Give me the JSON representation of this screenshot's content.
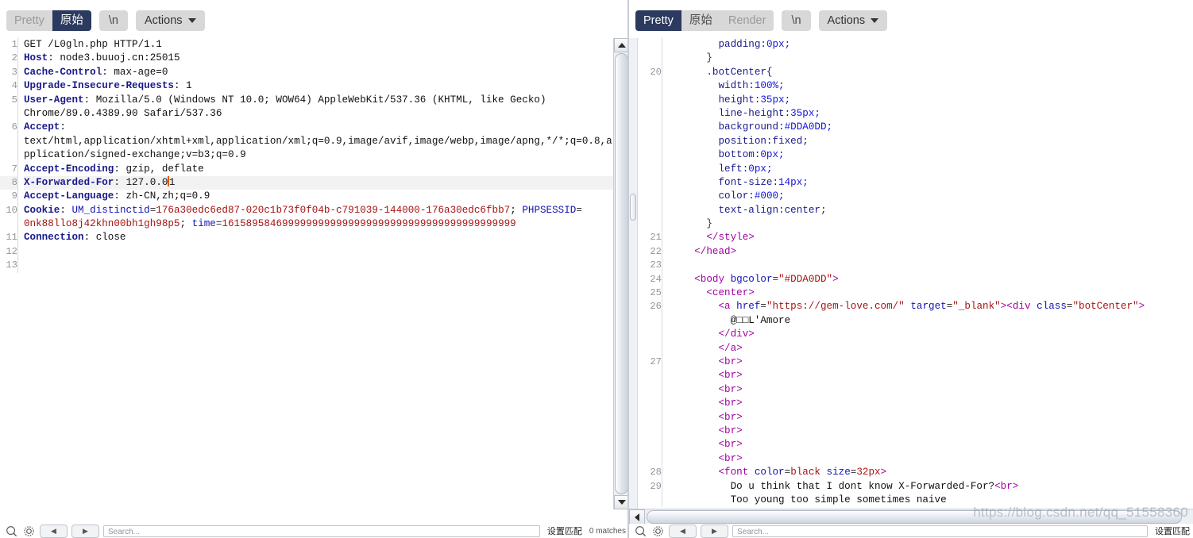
{
  "request_panel": {
    "toolbar": {
      "tabs": [
        {
          "label": "Pretty",
          "active": false
        },
        {
          "label": "原始",
          "active": true
        }
      ],
      "newline_label": "\\n",
      "actions_label": "Actions"
    },
    "line_numbers": [
      "1",
      "2",
      "3",
      "4",
      "5",
      "",
      "6",
      "",
      "",
      "7",
      "8",
      "9",
      "10",
      "",
      "11",
      "12",
      "13"
    ],
    "lines": [
      {
        "n": "1",
        "segments": [
          {
            "t": "GET /L0gln.php HTTP/1.1",
            "c": "k-val"
          }
        ]
      },
      {
        "n": "2",
        "segments": [
          {
            "t": "Host",
            "c": "k-hdr"
          },
          {
            "t": ": node3.buuoj.cn:25015",
            "c": "k-val"
          }
        ]
      },
      {
        "n": "3",
        "segments": [
          {
            "t": "Cache-Control",
            "c": "k-hdr"
          },
          {
            "t": ": max-age=0",
            "c": "k-val"
          }
        ]
      },
      {
        "n": "4",
        "segments": [
          {
            "t": "Upgrade-Insecure-Requests",
            "c": "k-hdr"
          },
          {
            "t": ": 1",
            "c": "k-val"
          }
        ]
      },
      {
        "n": "5",
        "segments": [
          {
            "t": "User-Agent",
            "c": "k-hdr"
          },
          {
            "t": ": Mozilla/5.0 (Windows NT 10.0; WOW64) AppleWebKit/537.36 (KHTML, like Gecko)",
            "c": "k-val"
          }
        ]
      },
      {
        "n": "",
        "segments": [
          {
            "t": "Chrome/89.0.4389.90 Safari/537.36",
            "c": "k-val"
          }
        ]
      },
      {
        "n": "6",
        "segments": [
          {
            "t": "Accept",
            "c": "k-hdr"
          },
          {
            "t": ":",
            "c": "k-val"
          }
        ]
      },
      {
        "n": "",
        "segments": [
          {
            "t": "text/html,application/xhtml+xml,application/xml;q=0.9,image/avif,image/webp,image/apng,*/*;q=0.8,a",
            "c": "k-val"
          }
        ]
      },
      {
        "n": "",
        "segments": [
          {
            "t": "pplication/signed-exchange;v=b3;q=0.9",
            "c": "k-val"
          }
        ]
      },
      {
        "n": "7",
        "segments": [
          {
            "t": "Accept-Encoding",
            "c": "k-hdr"
          },
          {
            "t": ": gzip, deflate",
            "c": "k-val"
          }
        ]
      },
      {
        "n": "8",
        "highlight": true,
        "segments": [
          {
            "t": "X-Forwarded-For",
            "c": "k-hdr"
          },
          {
            "t": ": 127.0.0",
            "c": "k-val"
          },
          {
            "t": "",
            "c": "caret"
          },
          {
            "t": "1",
            "c": "k-val"
          }
        ]
      },
      {
        "n": "9",
        "segments": [
          {
            "t": "Accept-Language",
            "c": "k-hdr"
          },
          {
            "t": ": zh-CN,zh;q=0.9",
            "c": "k-val"
          }
        ]
      },
      {
        "n": "10",
        "segments": [
          {
            "t": "Cookie",
            "c": "k-hdr"
          },
          {
            "t": ": ",
            "c": "k-val"
          },
          {
            "t": "UM_distinctid",
            "c": "k-ckey"
          },
          {
            "t": "=",
            "c": "k-punct"
          },
          {
            "t": "176a30edc6ed87-020c1b73f0f04b-c791039-144000-176a30edc6fbb7",
            "c": "k-cval"
          },
          {
            "t": "; ",
            "c": "k-val"
          },
          {
            "t": "PHPSESSID",
            "c": "k-ckey"
          },
          {
            "t": "=",
            "c": "k-punct"
          }
        ]
      },
      {
        "n": "",
        "segments": [
          {
            "t": "0nk88llo8j42khn00bh1gh98p5",
            "c": "k-cval"
          },
          {
            "t": "; ",
            "c": "k-val"
          },
          {
            "t": "time",
            "c": "k-ckey"
          },
          {
            "t": "=",
            "c": "k-punct"
          },
          {
            "t": "1615895846999999999999999999999999999999999999999",
            "c": "k-cval"
          }
        ]
      },
      {
        "n": "11",
        "segments": [
          {
            "t": "Connection",
            "c": "k-hdr"
          },
          {
            "t": ": close",
            "c": "k-val"
          }
        ]
      },
      {
        "n": "12",
        "segments": []
      },
      {
        "n": "13",
        "segments": []
      }
    ]
  },
  "response_panel": {
    "toolbar": {
      "tabs": [
        {
          "label": "Pretty",
          "active": true
        },
        {
          "label": "原始",
          "active": false
        },
        {
          "label": "Render",
          "active": false
        }
      ],
      "newline_label": "\\n",
      "actions_label": "Actions"
    },
    "lines": [
      {
        "n": "",
        "indent": 4,
        "segments": [
          {
            "t": "padding:",
            "c": "k-prop"
          },
          {
            "t": "0px;",
            "c": "k-pval"
          }
        ]
      },
      {
        "n": "",
        "indent": 3,
        "segments": [
          {
            "t": "}",
            "c": "k-punct"
          }
        ]
      },
      {
        "n": "20",
        "indent": 3,
        "segments": [
          {
            "t": ".botCenter{",
            "c": "k-prop"
          }
        ]
      },
      {
        "n": "",
        "indent": 4,
        "segments": [
          {
            "t": "width:",
            "c": "k-prop"
          },
          {
            "t": "100%;",
            "c": "k-pval"
          }
        ]
      },
      {
        "n": "",
        "indent": 4,
        "segments": [
          {
            "t": "height:",
            "c": "k-prop"
          },
          {
            "t": "35px;",
            "c": "k-pval"
          }
        ]
      },
      {
        "n": "",
        "indent": 4,
        "segments": [
          {
            "t": "line-height:",
            "c": "k-prop"
          },
          {
            "t": "35px;",
            "c": "k-pval"
          }
        ]
      },
      {
        "n": "",
        "indent": 4,
        "segments": [
          {
            "t": "background:",
            "c": "k-prop"
          },
          {
            "t": "#DDA0DD;",
            "c": "k-pval"
          }
        ]
      },
      {
        "n": "",
        "indent": 4,
        "segments": [
          {
            "t": "position:",
            "c": "k-prop"
          },
          {
            "t": "fixed;",
            "c": "k-prop"
          }
        ]
      },
      {
        "n": "",
        "indent": 4,
        "segments": [
          {
            "t": "bottom:",
            "c": "k-prop"
          },
          {
            "t": "0px;",
            "c": "k-pval"
          }
        ]
      },
      {
        "n": "",
        "indent": 4,
        "segments": [
          {
            "t": "left:",
            "c": "k-prop"
          },
          {
            "t": "0px;",
            "c": "k-pval"
          }
        ]
      },
      {
        "n": "",
        "indent": 4,
        "segments": [
          {
            "t": "font-size:",
            "c": "k-prop"
          },
          {
            "t": "14px;",
            "c": "k-pval"
          }
        ]
      },
      {
        "n": "",
        "indent": 4,
        "segments": [
          {
            "t": "color:",
            "c": "k-prop"
          },
          {
            "t": "#000;",
            "c": "k-pval"
          }
        ]
      },
      {
        "n": "",
        "indent": 4,
        "segments": [
          {
            "t": "text-align:",
            "c": "k-prop"
          },
          {
            "t": "center;",
            "c": "k-prop"
          }
        ]
      },
      {
        "n": "",
        "indent": 3,
        "segments": [
          {
            "t": "}",
            "c": "k-punct"
          }
        ]
      },
      {
        "n": "21",
        "indent": 3,
        "segments": [
          {
            "t": "</style>",
            "c": "k-tag"
          }
        ]
      },
      {
        "n": "22",
        "indent": 2,
        "segments": [
          {
            "t": "</head>",
            "c": "k-tag"
          }
        ]
      },
      {
        "n": "23",
        "indent": 0,
        "segments": []
      },
      {
        "n": "24",
        "indent": 2,
        "segments": [
          {
            "t": "<body ",
            "c": "k-tag"
          },
          {
            "t": "bgcolor",
            "c": "k-attr"
          },
          {
            "t": "=",
            "c": "k-punct"
          },
          {
            "t": "\"#DDA0DD\"",
            "c": "k-astr"
          },
          {
            "t": ">",
            "c": "k-tag"
          }
        ]
      },
      {
        "n": "25",
        "indent": 3,
        "segments": [
          {
            "t": "<center>",
            "c": "k-tag"
          }
        ]
      },
      {
        "n": "26",
        "indent": 4,
        "segments": [
          {
            "t": "<a ",
            "c": "k-tag"
          },
          {
            "t": "href",
            "c": "k-attr"
          },
          {
            "t": "=",
            "c": "k-punct"
          },
          {
            "t": "\"https://gem-love.com/\"",
            "c": "k-astr"
          },
          {
            "t": " ",
            "c": "k-val"
          },
          {
            "t": "target",
            "c": "k-attr"
          },
          {
            "t": "=",
            "c": "k-punct"
          },
          {
            "t": "\"_blank\"",
            "c": "k-astr"
          },
          {
            "t": "><div ",
            "c": "k-tag"
          },
          {
            "t": "class",
            "c": "k-attr"
          },
          {
            "t": "=",
            "c": "k-punct"
          },
          {
            "t": "\"botCenter\"",
            "c": "k-astr"
          },
          {
            "t": ">",
            "c": "k-tag"
          }
        ]
      },
      {
        "n": "",
        "indent": 5,
        "segments": [
          {
            "t": "@□□L'Amore",
            "c": "k-txt"
          }
        ]
      },
      {
        "n": "",
        "indent": 4,
        "segments": [
          {
            "t": "</div>",
            "c": "k-tag"
          }
        ]
      },
      {
        "n": "",
        "indent": 4,
        "segments": [
          {
            "t": "</a>",
            "c": "k-tag"
          }
        ]
      },
      {
        "n": "27",
        "indent": 4,
        "segments": [
          {
            "t": "<br>",
            "c": "k-tag"
          }
        ]
      },
      {
        "n": "",
        "indent": 4,
        "segments": [
          {
            "t": "<br>",
            "c": "k-tag"
          }
        ]
      },
      {
        "n": "",
        "indent": 4,
        "segments": [
          {
            "t": "<br>",
            "c": "k-tag"
          }
        ]
      },
      {
        "n": "",
        "indent": 4,
        "segments": [
          {
            "t": "<br>",
            "c": "k-tag"
          }
        ]
      },
      {
        "n": "",
        "indent": 4,
        "segments": [
          {
            "t": "<br>",
            "c": "k-tag"
          }
        ]
      },
      {
        "n": "",
        "indent": 4,
        "segments": [
          {
            "t": "<br>",
            "c": "k-tag"
          }
        ]
      },
      {
        "n": "",
        "indent": 4,
        "segments": [
          {
            "t": "<br>",
            "c": "k-tag"
          }
        ]
      },
      {
        "n": "",
        "indent": 4,
        "segments": [
          {
            "t": "<br>",
            "c": "k-tag"
          }
        ]
      },
      {
        "n": "28",
        "indent": 4,
        "segments": [
          {
            "t": "<font ",
            "c": "k-tag"
          },
          {
            "t": "color",
            "c": "k-attr"
          },
          {
            "t": "=",
            "c": "k-punct"
          },
          {
            "t": "black",
            "c": "k-astr"
          },
          {
            "t": " ",
            "c": "k-val"
          },
          {
            "t": "size",
            "c": "k-attr"
          },
          {
            "t": "=",
            "c": "k-punct"
          },
          {
            "t": "32px",
            "c": "k-astr"
          },
          {
            "t": ">",
            "c": "k-tag"
          }
        ]
      },
      {
        "n": "29",
        "indent": 5,
        "segments": [
          {
            "t": "Do u think that I dont know X-Forwarded-For?",
            "c": "k-txt"
          },
          {
            "t": "<br>",
            "c": "k-tag"
          }
        ]
      },
      {
        "n": "",
        "indent": 5,
        "segments": [
          {
            "t": "Too young too simple sometimes naive",
            "c": "k-txt"
          }
        ]
      }
    ]
  },
  "bottom_bar": {
    "search_placeholder": "Search...",
    "matches_label": "设置匹配",
    "match_count": "0 matches"
  },
  "watermark": "https://blog.csdn.net/qq_51558360",
  "colors": {
    "accent_active_tab": "#2b3a5e",
    "toolbar_button": "#d8d8d8",
    "header_name": "#1a1a8c",
    "cookie_key": "#1414b4",
    "cookie_value": "#a51414",
    "html_tag": "#a000a0",
    "attr_value": "#a51414",
    "css_value": "#1414e0",
    "caret": "#e2590b",
    "active_line": "#f2f2f2"
  }
}
